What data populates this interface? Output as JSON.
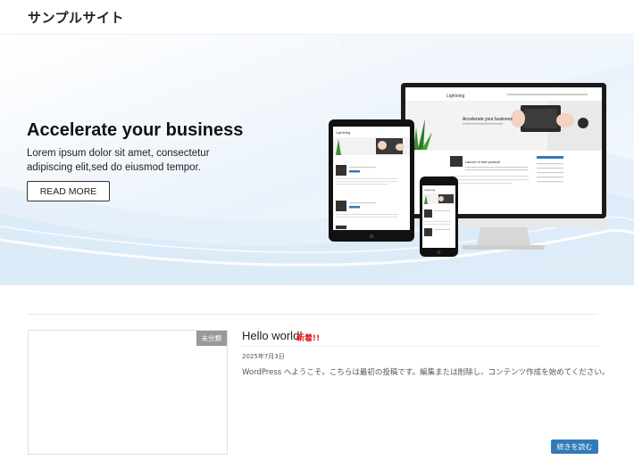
{
  "header": {
    "site_title": "サンプルサイト"
  },
  "hero": {
    "title": "Accelerate your business",
    "text": "Lorem ipsum dolor sit amet, consectetur adipiscing elit,sed do eiusmod tempor.",
    "button_label": "READ MORE",
    "slides": 2,
    "active_slide": 1,
    "mockup": {
      "brand": "Lightning",
      "headline": "Accelerate your business",
      "post_title": "Launch of new product!"
    }
  },
  "post": {
    "category": "未分類",
    "title": "Hello world!",
    "new_label": "新着!!",
    "date": "2025年7月3日",
    "excerpt": "WordPress へようこそ。こちらは最初の投稿です。編集または削除し、コンテンツ作成を始めてください。",
    "read_more_label": "続きを読む"
  },
  "colors": {
    "accent": "#337ab7",
    "new_label": "#e81d1d",
    "badge": "#999999"
  }
}
